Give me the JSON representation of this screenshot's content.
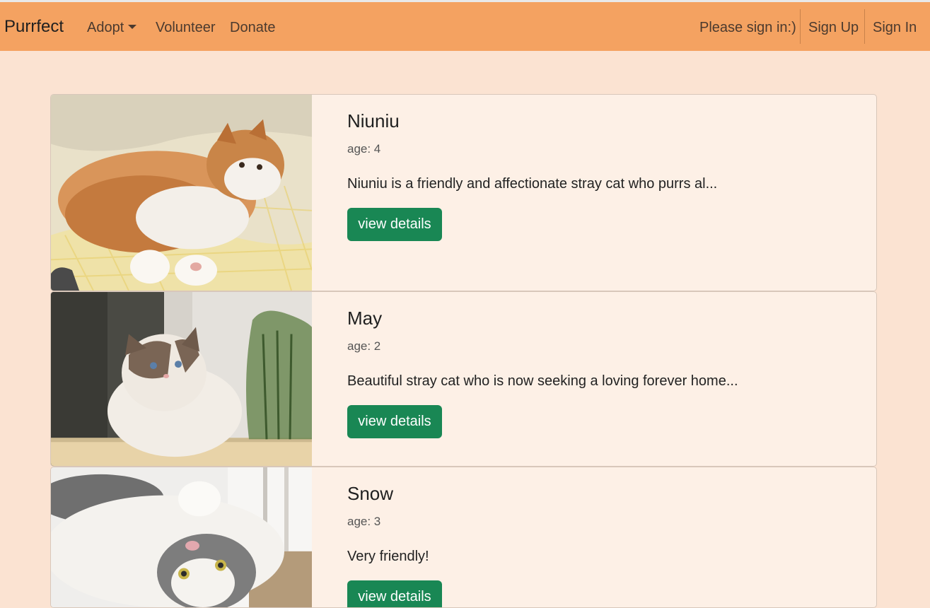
{
  "navbar": {
    "brand": "Purrfect",
    "links": [
      {
        "label": "Adopt"
      },
      {
        "label": "Volunteer"
      },
      {
        "label": "Donate"
      }
    ],
    "sign_prompt": "Please sign in:)",
    "sign_up": "Sign Up",
    "sign_in": "Sign In"
  },
  "cats": [
    {
      "name": "Niuniu",
      "age": "age: 4",
      "description": "Niuniu is a friendly and affectionate stray cat who purrs al...",
      "button": "view details",
      "image_alt": "orange and white cat lying on bed"
    },
    {
      "name": "May",
      "age": "age: 2",
      "description": "Beautiful stray cat who is now seeking a loving forever home...",
      "button": "view details",
      "image_alt": "fluffy ragdoll cat sitting by a vase"
    },
    {
      "name": "Snow",
      "age": "age: 3",
      "description": "Very friendly!",
      "button": "view details",
      "image_alt": "white and grey cat lying upside down"
    }
  ],
  "colors": {
    "page_bg": "#fbe3d2",
    "navbar_bg": "#f4a261",
    "card_bg": "#fdf0e6",
    "button_bg": "#198754"
  }
}
